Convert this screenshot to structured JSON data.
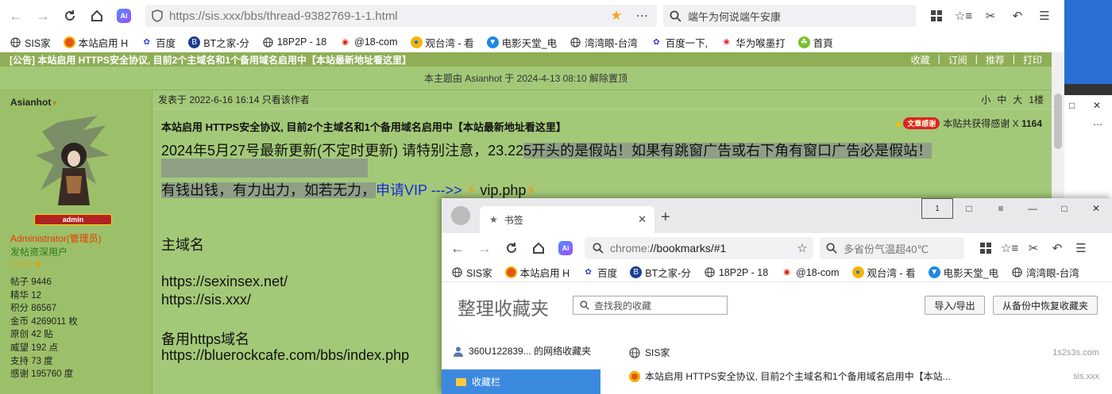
{
  "browser1": {
    "url": "https://sis.xxx/bbs/thread-9382769-1-1.html",
    "search_text": "端午为何说端午安康",
    "ai_label": "Ai"
  },
  "bookmarks1": [
    {
      "label": "SIS家",
      "icon": "globe-icon"
    },
    {
      "label": "本站启用 H",
      "icon": "flower-icon"
    },
    {
      "label": "百度",
      "icon": "paw-icon"
    },
    {
      "label": "BT之家-分",
      "icon": "bt-icon"
    },
    {
      "label": "18P2P - 18",
      "icon": "globe-icon"
    },
    {
      "label": "@18-com",
      "icon": "eye-icon"
    },
    {
      "label": "观台湾 - 看",
      "icon": "chrome-icon"
    },
    {
      "label": "电影天堂_电",
      "icon": "shield-icon"
    },
    {
      "label": "湾湾眼-台湾",
      "icon": "globe-icon"
    },
    {
      "label": "百度一下,",
      "icon": "paw-icon"
    },
    {
      "label": "华为喉墨打",
      "icon": "huawei-icon"
    },
    {
      "label": "首頁",
      "icon": "leaf-icon"
    }
  ],
  "forum": {
    "thread_title": "[公告] 本站启用 HTTPS安全协议, 目前2个主域名和1个备用域名启用中【本站最新地址看这里】",
    "actions": [
      "收藏",
      "订阅",
      "推荐",
      "打印"
    ],
    "lock_notice": "本主题由 Asianhot 于 2024-4-13 08:10 解除置顶",
    "user": {
      "name": "Asianhot",
      "badge": "admin",
      "role": "Administrator(管理员)",
      "subrole": "发帖资深用户",
      "stats": [
        "帖子 9446",
        "精华 12",
        "积分 86567",
        "金币 4269011 枚",
        "原创 42 贴",
        "威望 192 点",
        "支持 73 度",
        "感谢 195760 度"
      ]
    },
    "post_meta": "发表于 2022-6-16 16:14  只看该作者",
    "font_sizes": [
      "小",
      "中",
      "大"
    ],
    "floor": "1楼",
    "post_title": "本站启用 HTTPS安全协议, 目前2个主域名和1个备用域名启用中【本站最新地址看这里】",
    "thanks_label": "本贴共获得感谢 X",
    "thanks_count": "1164",
    "thanks_badge": "文章感谢",
    "body": {
      "line1": "2024年5月27号最新更新(不定时更新) 请特别注意，23.22",
      "line1_hl": "5开头的是假站！如果有跳窗广告或右下角有窗口广告必是假站！",
      "line2": "有钱出钱，有力出力，如若无力，",
      "vip_link": "申请VIP --->>",
      "vip_file": "vip.php",
      "domains_head": "主域名",
      "domain1": "https://sexinsex.net/",
      "domain2": "https://sis.xxx/",
      "backup_head": "备用https域名",
      "backup1": "https://bluerockcafe.com/bbs/index.php"
    }
  },
  "browser2": {
    "tab_title": "书签",
    "tab_count": "1",
    "url_scheme": "chrome:",
    "url_rest": "//bookmarks/#1",
    "search_text": "多省份气温超40℃",
    "ai_label": "Ai",
    "bookmarks": [
      {
        "label": "SIS家",
        "icon": "globe-icon"
      },
      {
        "label": "本站启用 H",
        "icon": "flower-icon"
      },
      {
        "label": "百度",
        "icon": "paw-icon"
      },
      {
        "label": "BT之家-分",
        "icon": "bt-icon"
      },
      {
        "label": "18P2P - 18",
        "icon": "globe-icon"
      },
      {
        "label": "@18-com",
        "icon": "eye-icon"
      },
      {
        "label": "观台湾 - 看",
        "icon": "chrome-icon"
      },
      {
        "label": "电影天堂_电",
        "icon": "shield-icon"
      },
      {
        "label": "湾湾眼-台湾",
        "icon": "globe-icon"
      }
    ],
    "manager": {
      "title": "整理收藏夹",
      "search_placeholder": "查找我的收藏",
      "import_export": "导入/导出",
      "restore": "从备份中恢复收藏夹",
      "account": "360U122839... 的网络收藏夹",
      "selected_folder": "收藏栏",
      "items": [
        {
          "title": "SIS家",
          "domain": "1s2s3s.com",
          "icon": "globe-icon"
        },
        {
          "title": "本站启用 HTTPS安全协议, 目前2个主域名和1个备用域名启用中【本站...",
          "domain": "sis.xxx",
          "icon": "flower-icon"
        }
      ]
    }
  },
  "colors": {
    "forum_bg": "#a3c978",
    "vip_link": "#1a2bd4",
    "selected_folder": "#3c8ae0"
  }
}
